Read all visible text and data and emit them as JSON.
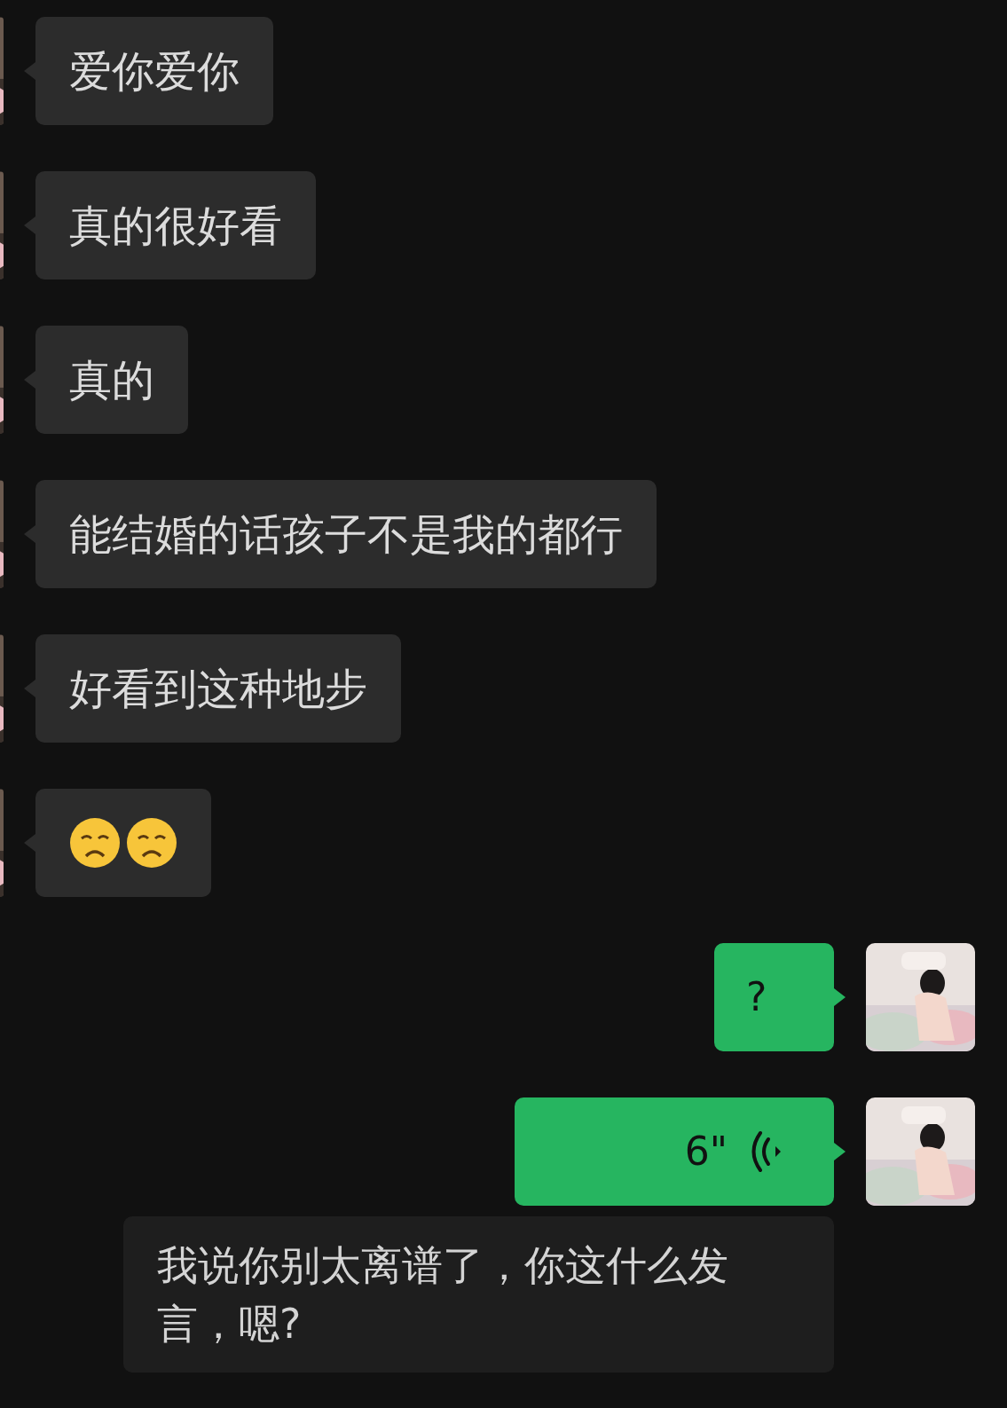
{
  "received": [
    {
      "kind": "text",
      "text": "爱你爱你"
    },
    {
      "kind": "text",
      "text": "真的很好看"
    },
    {
      "kind": "text",
      "text": "真的"
    },
    {
      "kind": "text",
      "text": "能结婚的话孩子不是我的都行"
    },
    {
      "kind": "text",
      "text": "好看到这种地步"
    },
    {
      "kind": "emoji"
    }
  ],
  "sent": [
    {
      "kind": "text",
      "text": "?"
    },
    {
      "kind": "voice",
      "duration": "6\""
    }
  ],
  "transcript": {
    "text": "我说你别太离谱了，你这什么发言，嗯?"
  }
}
